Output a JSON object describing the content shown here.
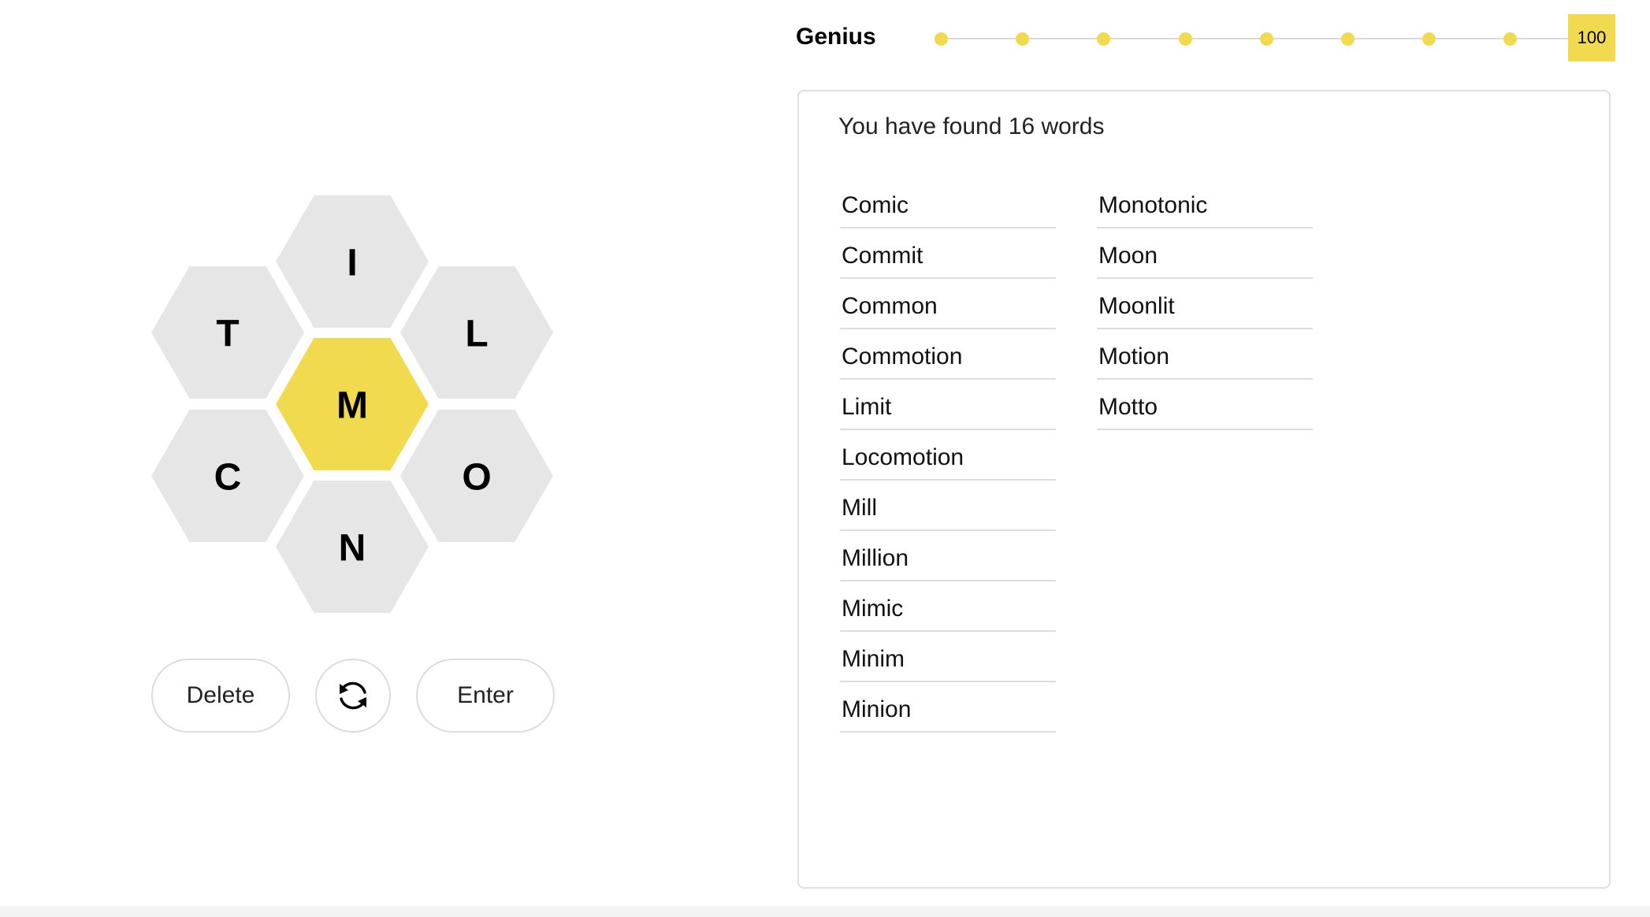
{
  "hive": {
    "center_letter": "M",
    "outer_letters": [
      "I",
      "L",
      "O",
      "N",
      "C",
      "T"
    ]
  },
  "actions": {
    "delete_label": "Delete",
    "shuffle_icon": "shuffle-icon",
    "enter_label": "Enter"
  },
  "progress": {
    "rank": "Genius",
    "score": "100",
    "dot_count": 8,
    "colors": {
      "accent": "#f2da4f",
      "cell": "#e6e6e6"
    }
  },
  "word_list": {
    "summary": "You have found 16 words",
    "columns": [
      [
        "Comic",
        "Commit",
        "Common",
        "Commotion",
        "Limit",
        "Locomotion",
        "Mill",
        "Million",
        "Mimic",
        "Minim",
        "Minion"
      ],
      [
        "Monotonic",
        "Moon",
        "Moonlit",
        "Motion",
        "Motto"
      ]
    ]
  }
}
